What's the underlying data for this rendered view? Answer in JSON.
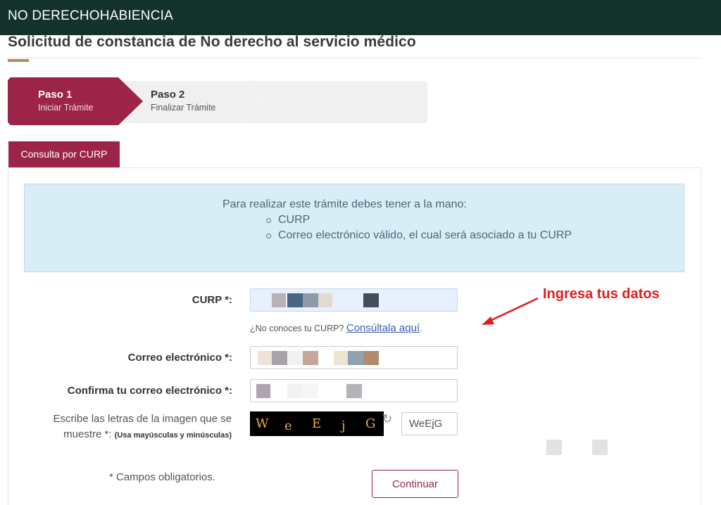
{
  "header": {
    "title": "NO DERECHOHABIENCIA"
  },
  "page": {
    "title": "Solicitud de constancia de No derecho al servicio médico"
  },
  "stepper": [
    {
      "title": "Paso 1",
      "subtitle": "Iniciar Trámite",
      "active": true
    },
    {
      "title": "Paso 2",
      "subtitle": "Finalizar Trámite",
      "active": false
    }
  ],
  "tabs": [
    {
      "label": "Consulta por CURP",
      "active": true
    }
  ],
  "info": {
    "intro": "Para realizar este trámite debes tener a la mano:",
    "items": [
      "CURP",
      "Correo electrónico válido, el cual será asociado a tu CURP"
    ]
  },
  "form": {
    "curp": {
      "label": "CURP *:",
      "value": ""
    },
    "curp_help": {
      "text": "¿No conoces tu CURP? ",
      "link": "Consúltala aquí",
      "suffix": "."
    },
    "email": {
      "label": "Correo electrónico *:",
      "value": ""
    },
    "email_confirm": {
      "label": "Confirma tu correo electrónico *:",
      "value": ""
    },
    "captcha": {
      "label": "Escribe las letras de la imagen que se muestre *:",
      "note": "(Usa mayúsculas y minúsculas)",
      "image_letters": [
        "W",
        "e",
        "E",
        "j",
        "G"
      ],
      "value": "WeEjG"
    },
    "required_note": "* Campos obligatorios.",
    "submit_label": "Continuar"
  },
  "annotation": {
    "text": "Ingresa tus datos",
    "color": "#e11b1b"
  },
  "colors": {
    "header_bg": "#13322b",
    "accent": "#9d2449",
    "title_underline": "#b08a60",
    "info_bg": "#d9edf7"
  }
}
